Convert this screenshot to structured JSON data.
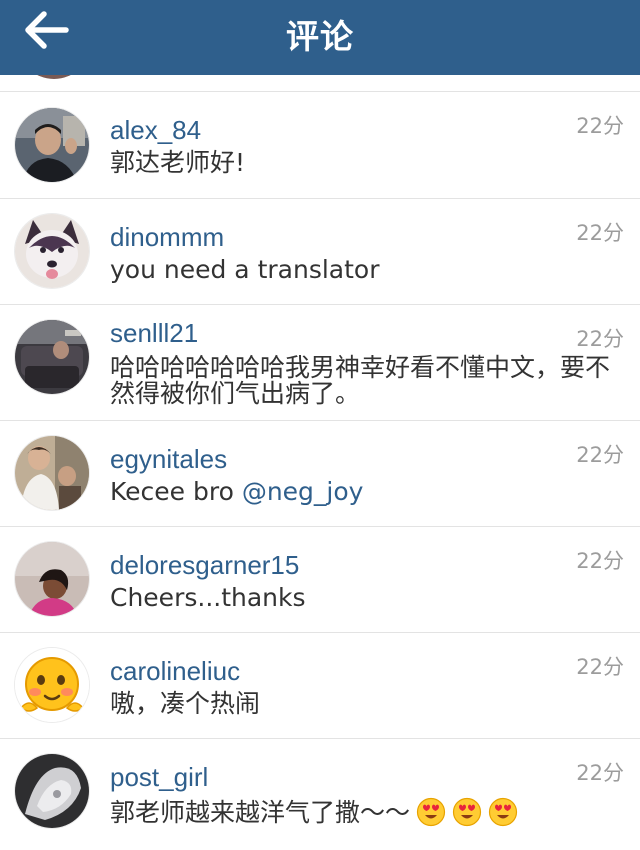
{
  "header": {
    "title": "评论",
    "back_icon": "arrow-left-icon"
  },
  "colors": {
    "navbar": "#2f5f8c",
    "username": "#2f5f8c",
    "timestamp": "#9c9c9c",
    "text": "#333333"
  },
  "comments": [
    {
      "username": "alex_84",
      "text": "郭达老师好!",
      "time": "22分",
      "avatar": "avatar-man-photo"
    },
    {
      "username": "dinommm",
      "text": "you need a translator",
      "time": "22分",
      "avatar": "avatar-husky-photo"
    },
    {
      "username": "senlll21",
      "text": "哈哈哈哈哈哈哈我男神幸好看不懂中文，要不然得被你们气出病了。",
      "time": "22分",
      "avatar": "avatar-car-interior-photo"
    },
    {
      "username": "egynitales",
      "text_prefix": "Kecee bro ",
      "mention": "@neg_joy",
      "time": "22分",
      "avatar": "avatar-child-photo"
    },
    {
      "username": "deloresgarner15",
      "text": "Cheers...thanks",
      "time": "22分",
      "avatar": "avatar-woman-photo"
    },
    {
      "username": "carolineliuc",
      "text": "嗷，凑个热闹",
      "time": "22分",
      "avatar": "avatar-cartoon-face"
    },
    {
      "username": "post_girl",
      "text": "郭老师越来越洋气了撒～～",
      "emojis": [
        "heart-eyes-emoji",
        "heart-eyes-emoji",
        "heart-eyes-emoji"
      ],
      "time": "22分",
      "avatar": "avatar-flower-photo"
    }
  ]
}
